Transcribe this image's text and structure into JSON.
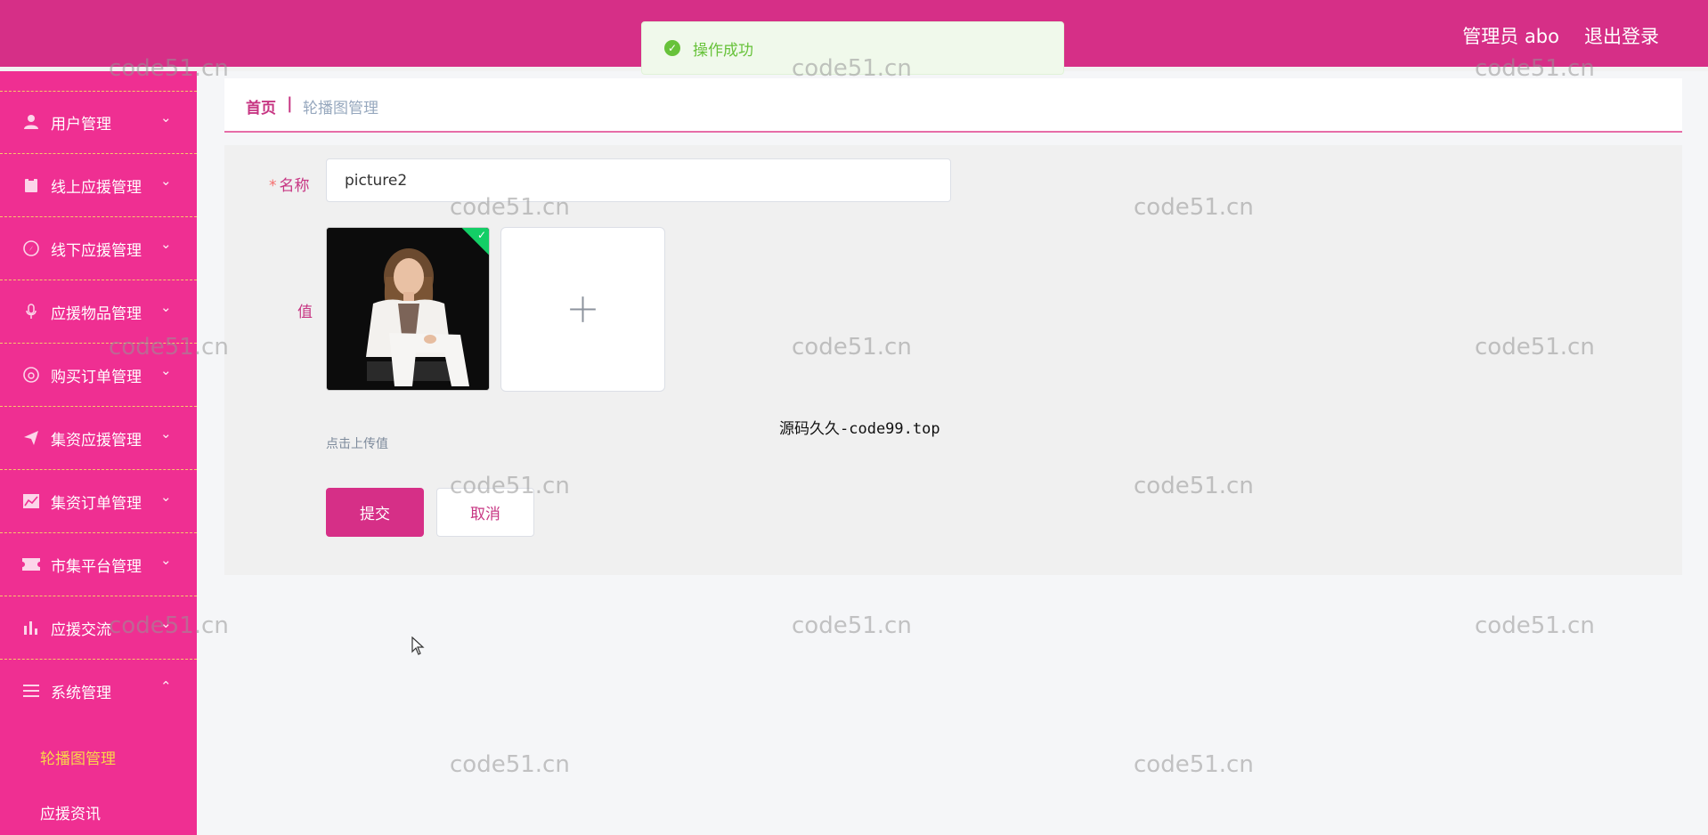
{
  "header": {
    "user_label": "管理员 abo",
    "logout_label": "退出登录"
  },
  "toast": {
    "message": "操作成功"
  },
  "sidebar": {
    "items": [
      {
        "label": "用户管理",
        "icon": "user-icon",
        "expanded": false
      },
      {
        "label": "线上应援管理",
        "icon": "clipboard-icon",
        "expanded": false
      },
      {
        "label": "线下应援管理",
        "icon": "compass-icon",
        "expanded": false
      },
      {
        "label": "应援物品管理",
        "icon": "microphone-icon",
        "expanded": false
      },
      {
        "label": "购买订单管理",
        "icon": "gauge-icon",
        "expanded": false
      },
      {
        "label": "集资应援管理",
        "icon": "paper-plane-icon",
        "expanded": false
      },
      {
        "label": "集资订单管理",
        "icon": "chart-area-icon",
        "expanded": false
      },
      {
        "label": "市集平台管理",
        "icon": "ticket-icon",
        "expanded": false
      },
      {
        "label": "应援交流",
        "icon": "bar-chart-icon",
        "expanded": false
      },
      {
        "label": "系统管理",
        "icon": "list-icon",
        "expanded": true
      }
    ],
    "sub_items": [
      {
        "label": "轮播图管理",
        "active": true
      },
      {
        "label": "应援资讯",
        "active": false
      }
    ]
  },
  "breadcrumb": {
    "home": "首页",
    "separator": "|",
    "current": "轮播图管理"
  },
  "form": {
    "name_label": "名称",
    "required_mark": "*",
    "name_value": "picture2",
    "value_label": "值",
    "upload_hint": "点击上传值",
    "submit_label": "提交",
    "cancel_label": "取消"
  },
  "overlay_note": "源码久久-code99.top",
  "watermark_text": "code51.cn",
  "colors": {
    "header": "#d62f87",
    "sidebar": "#ef2f92",
    "accent": "#c73683",
    "active_submenu": "#f8d64a",
    "success": "#67c23a"
  }
}
